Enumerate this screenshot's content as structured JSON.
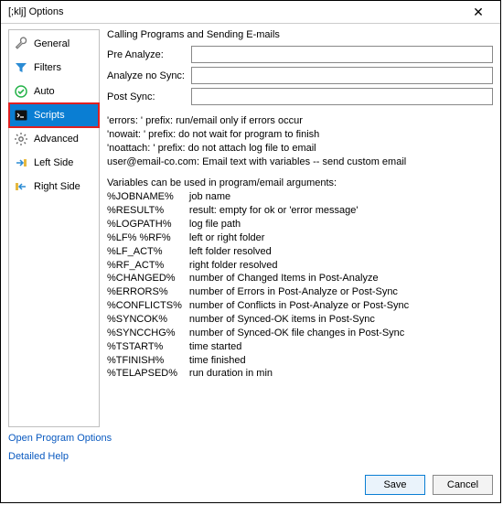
{
  "window": {
    "title": "[;klj] Options"
  },
  "sidebar": {
    "items": [
      {
        "label": "General"
      },
      {
        "label": "Filters"
      },
      {
        "label": "Auto"
      },
      {
        "label": "Scripts"
      },
      {
        "label": "Advanced"
      },
      {
        "label": "Left Side"
      },
      {
        "label": "Right Side"
      }
    ],
    "selected_index": 3
  },
  "section": {
    "title": "Calling Programs and Sending E-mails"
  },
  "fields": {
    "pre_analyze": {
      "label": "Pre Analyze:",
      "value": ""
    },
    "analyze_no_sync": {
      "label": "Analyze no Sync:",
      "value": ""
    },
    "post_sync": {
      "label": "Post Sync:",
      "value": ""
    }
  },
  "help_lines": [
    "'errors: ' prefix: run/email only if errors occur",
    "'nowait: ' prefix: do not wait for program to finish",
    "'noattach: ' prefix: do not attach log file to email",
    "user@email-co.com: Email text with variables -- send custom email"
  ],
  "vars_title": "Variables can be used in program/email arguments:",
  "vars": [
    {
      "name": "%JOBNAME%",
      "desc": "job name"
    },
    {
      "name": "%RESULT%",
      "desc": "result: empty for ok or 'error message'"
    },
    {
      "name": "%LOGPATH%",
      "desc": "log file path"
    },
    {
      "name": "%LF% %RF%",
      "desc": "left or right folder"
    },
    {
      "name": "%LF_ACT%",
      "desc": "left folder resolved"
    },
    {
      "name": "%RF_ACT%",
      "desc": "right folder resolved"
    },
    {
      "name": "%CHANGED%",
      "desc": "number of Changed Items in Post-Analyze"
    },
    {
      "name": "%ERRORS%",
      "desc": "number of Errors in Post-Analyze or Post-Sync"
    },
    {
      "name": "%CONFLICTS%",
      "desc": "number of Conflicts in Post-Analyze or Post-Sync"
    },
    {
      "name": "%SYNCOK%",
      "desc": "number of Synced-OK items in Post-Sync"
    },
    {
      "name": "%SYNCCHG%",
      "desc": "number of Synced-OK file changes in Post-Sync"
    },
    {
      "name": "%TSTART%",
      "desc": "time started"
    },
    {
      "name": "%TFINISH%",
      "desc": "time finished"
    },
    {
      "name": "%TELAPSED%",
      "desc": "run duration in min"
    }
  ],
  "links": {
    "program_options": "Open Program Options",
    "detailed_help": "Detailed Help"
  },
  "buttons": {
    "save": "Save",
    "cancel": "Cancel"
  }
}
